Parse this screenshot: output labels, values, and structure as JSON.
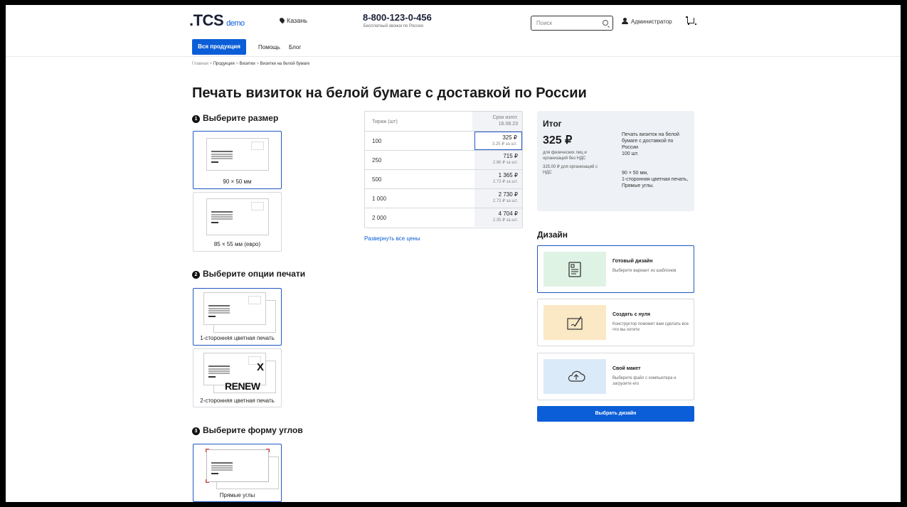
{
  "header": {
    "logo": ".TCS",
    "logo_tag": "demo",
    "city": "Казань",
    "phone": "8-800-123-0-456",
    "phone_note": "Бесплатный звонок по России",
    "search_placeholder": "Поиск",
    "user": "Администратор"
  },
  "nav": {
    "all_products": "Вся продукция",
    "help": "Помощь",
    "blog": "Блог"
  },
  "breadcrumb": {
    "home": "Главная",
    "sep": ">",
    "products": "Продукция",
    "cards": "Визитки",
    "current": "Визитки на белой бумаге"
  },
  "page_title": "Печать визиток на белой бумаге с доставкой по России",
  "steps": {
    "size": {
      "num": "1",
      "title": "Выберите размер",
      "options": [
        "90 × 50 мм",
        "85 × 55 мм (евро)"
      ],
      "selected": 0
    },
    "print": {
      "num": "2",
      "title": "Выберите опции печати",
      "options": [
        "1-сторонняя цветная печать",
        "2-сторонняя цветная печать"
      ],
      "selected": 0,
      "overlay_text": "RENEW",
      "overlay_mark": "X"
    },
    "corners": {
      "num": "3",
      "title": "Выберите форму углов",
      "options": [
        "Прямые углы"
      ],
      "selected": 0
    }
  },
  "price_table": {
    "col_qty": "Тираж (шт)",
    "col_term": "Срок изгот.",
    "col_date": "16.08.23",
    "rows": [
      {
        "qty": "100",
        "price": "325 ₽",
        "unit": "3.25 ₽ за шт."
      },
      {
        "qty": "250",
        "price": "715 ₽",
        "unit": "2.86 ₽ за шт."
      },
      {
        "qty": "500",
        "price": "1 365 ₽",
        "unit": "2.73 ₽ за шт."
      },
      {
        "qty": "1 000",
        "price": "2 730 ₽",
        "unit": "2.73 ₽ за шт."
      },
      {
        "qty": "2 000",
        "price": "4 704 ₽",
        "unit": "2.35 ₽ за шт."
      }
    ],
    "selected_row": 0,
    "expand": "Развернуть все цены"
  },
  "summary": {
    "title": "Итог",
    "price": "325 ₽",
    "note1": "для физических лиц и организаций без НДС",
    "note2": "325.00 ₽ для организаций с НДС",
    "desc": "Печать визиток на белой бумаге с доставкой по России",
    "qty": "100 шт.",
    "size": "90 × 50 мм,",
    "print": "1-сторонняя цветная печать,",
    "corners": "Прямые углы."
  },
  "design": {
    "title": "Дизайн",
    "options": [
      {
        "title": "Готовый дизайн",
        "desc": "Выберите вариант из шаблонов",
        "color": "#dff3e4",
        "icon": "template-icon"
      },
      {
        "title": "Создать с нуля",
        "desc": "Конструктор поможет вам сделать все что вы хотите",
        "color": "#fbe8c4",
        "icon": "draw-icon"
      },
      {
        "title": "Свой макет",
        "desc": "Выберите файл с компьютера и загрузите его",
        "color": "#dbeaf8",
        "icon": "cloud-upload-icon"
      }
    ],
    "selected": 0,
    "button": "Выбрать дизайн"
  },
  "colors": {
    "accent": "#0b5ed7",
    "selected_border": "#1f57c4",
    "panel": "#eef1f5"
  }
}
